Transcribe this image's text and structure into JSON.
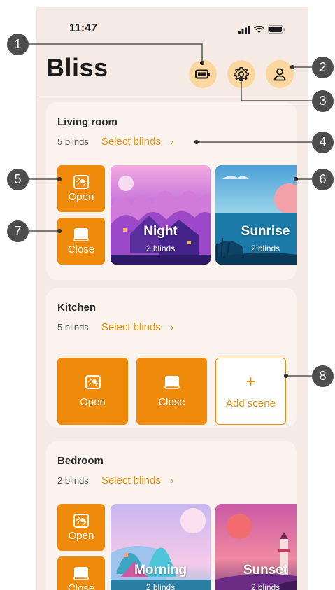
{
  "status": {
    "time": "11:47"
  },
  "app": {
    "logo": "Bliss"
  },
  "header": {
    "icons": [
      "battery-icon",
      "gear-icon",
      "user-icon"
    ],
    "accent": "#fbd79f"
  },
  "rooms": [
    {
      "name": "Living room",
      "count": "5 blinds",
      "select": "Select blinds",
      "actions": [
        {
          "label": "Open",
          "icon": "open-blind-icon"
        },
        {
          "label": "Close",
          "icon": "close-blind-icon"
        }
      ],
      "scenes": [
        {
          "name": "Night",
          "count": "2 blinds"
        },
        {
          "name": "Sunrise",
          "count": "2 blinds"
        }
      ]
    },
    {
      "name": "Kitchen",
      "count": "5 blinds",
      "select": "Select blinds",
      "actions": [
        {
          "label": "Open",
          "icon": "open-blind-icon"
        },
        {
          "label": "Close",
          "icon": "close-blind-icon"
        }
      ],
      "add": {
        "plus": "+",
        "label": "Add scene"
      }
    },
    {
      "name": "Bedroom",
      "count": "2 blinds",
      "select": "Select blinds",
      "actions": [
        {
          "label": "Open",
          "icon": "open-blind-icon"
        },
        {
          "label": "Close",
          "icon": "close-blind-icon"
        }
      ],
      "scenes": [
        {
          "name": "Morning",
          "count": "2 blinds"
        },
        {
          "name": "Sunset",
          "count": "2 blinds"
        }
      ]
    }
  ],
  "callouts": [
    "1",
    "2",
    "3",
    "4",
    "5",
    "6",
    "7",
    "8"
  ],
  "colors": {
    "primary": "#ef8a0a",
    "link": "#e69416",
    "background": "#f6ebe4",
    "card": "#fcf3ee",
    "callout": "#4d4d4d"
  }
}
